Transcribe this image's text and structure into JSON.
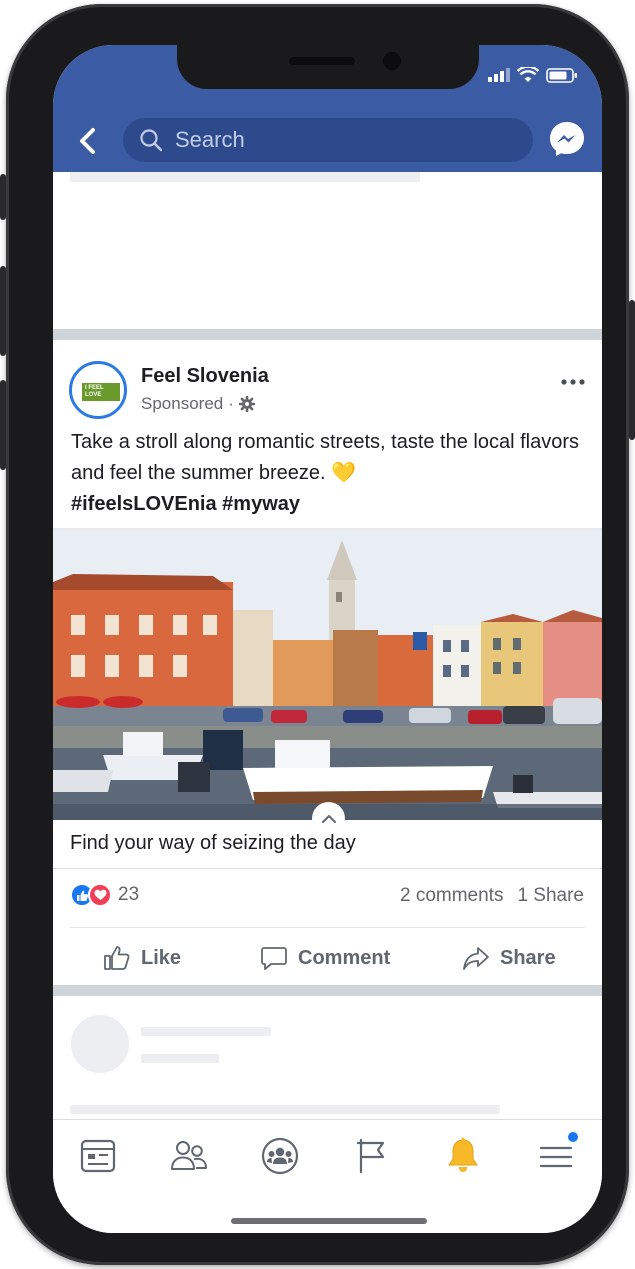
{
  "header": {
    "search_placeholder": "Search"
  },
  "post": {
    "page_name": "Feel Slovenia",
    "sponsored_label": "Sponsored",
    "sponsored_separator": "·",
    "avatar_logo_text": "I FEEL LOVE",
    "text": "Take a stroll along romantic streets, taste the local flavors and feel the summer breeze. 💛",
    "hashtags": "#ifeelsLOVEnia #myway",
    "caption": "Find your way of seizing the day",
    "reaction_count": "23",
    "comments": "2 comments",
    "shares": "1 Share",
    "actions": {
      "like": "Like",
      "comment": "Comment",
      "share": "Share"
    }
  },
  "icons": {
    "back": "chevron-left-icon",
    "search": "search-icon",
    "messenger": "messenger-icon",
    "more": "more-horizontal-icon",
    "settings": "gear-icon",
    "like_reaction": "thumbs-up-icon",
    "love_reaction": "heart-icon",
    "expand": "chevron-up-icon",
    "nav": [
      "news-feed-icon",
      "friends-icon",
      "groups-icon",
      "pages-flag-icon",
      "notifications-bell-icon",
      "menu-icon"
    ]
  },
  "colors": {
    "header_bg": "#3b5ba4",
    "search_bg": "#2d4a8c",
    "like_blue": "#1877f2",
    "love_red": "#f33e58",
    "bell_yellow": "#f7b928"
  }
}
